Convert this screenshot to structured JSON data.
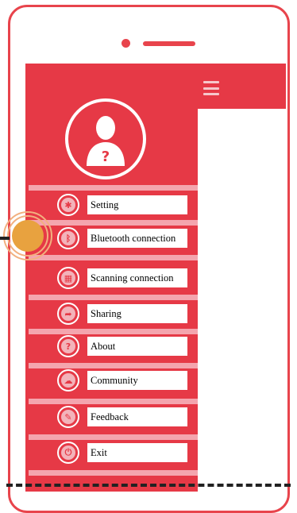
{
  "colors": {
    "accent": "#e63946",
    "phone_frame": "#e8444c",
    "divider": "#f4a5ae",
    "touch_indicator": "#e8a23f"
  },
  "header": {
    "menu_icon": "hamburger-icon"
  },
  "profile": {
    "avatar_icon": "user-question-icon"
  },
  "menu": {
    "items": [
      {
        "label": "Setting",
        "icon": "gear-icon"
      },
      {
        "label": "Bluetooth connection",
        "icon": "bluetooth-icon"
      },
      {
        "label": "Scanning connection",
        "icon": "qr-scan-icon"
      },
      {
        "label": "Sharing",
        "icon": "share-icon"
      },
      {
        "label": "About",
        "icon": "question-icon"
      },
      {
        "label": "Community",
        "icon": "community-icon"
      },
      {
        "label": "Feedback",
        "icon": "feedback-icon"
      },
      {
        "label": "Exit",
        "icon": "exit-icon"
      }
    ]
  }
}
